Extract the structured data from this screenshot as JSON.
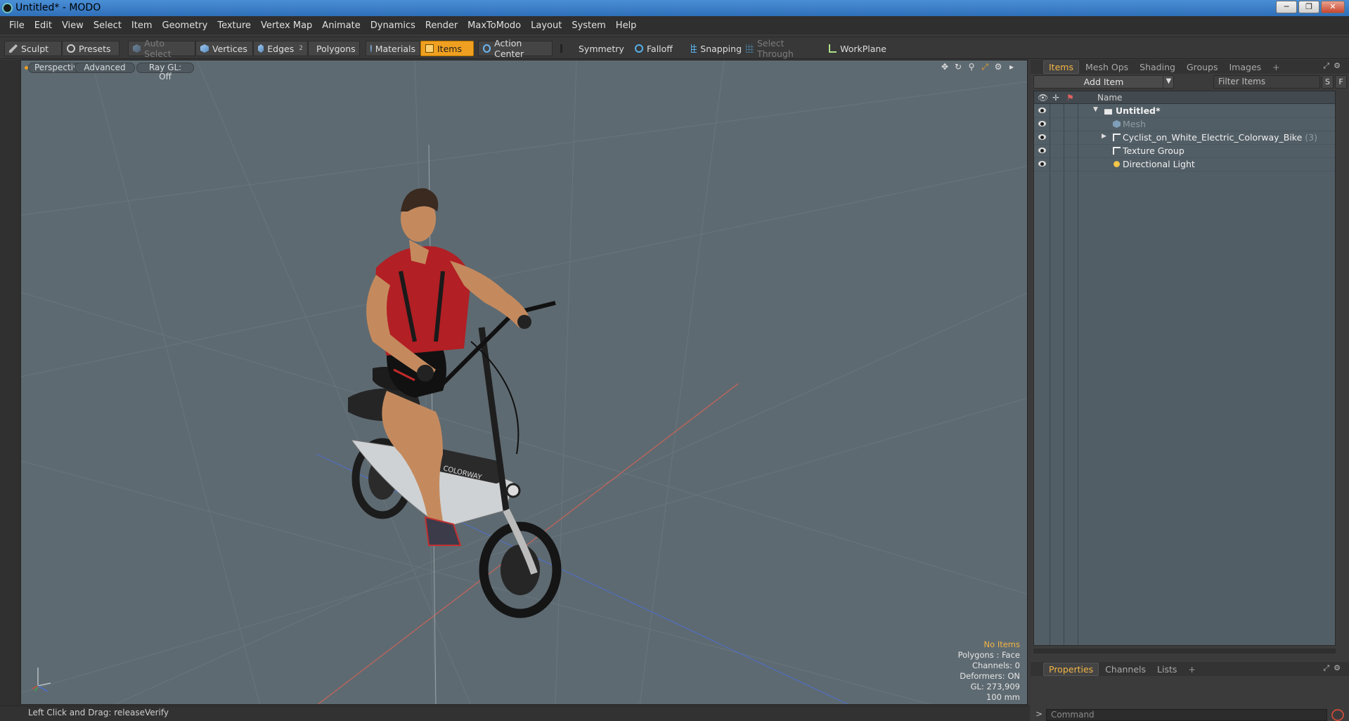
{
  "window": {
    "title": "Untitled* - MODO",
    "controls": [
      "─",
      "❐",
      "✕"
    ]
  },
  "menu": [
    "File",
    "Edit",
    "View",
    "Select",
    "Item",
    "Geometry",
    "Texture",
    "Vertex Map",
    "Animate",
    "Dynamics",
    "Render",
    "MaxToModo",
    "Layout",
    "System",
    "Help"
  ],
  "toolbar": {
    "sculpt": "Sculpt",
    "presets": "Presets",
    "auto_select": "Auto Select",
    "vertices": "Vertices",
    "edges": "Edges",
    "edges_count": "2",
    "polygons": "Polygons",
    "materials": "Materials",
    "items": "Items",
    "action_center": "Action Center",
    "symmetry": "Symmetry",
    "falloff": "Falloff",
    "snapping": "Snapping",
    "select_through": "Select Through",
    "workplane": "WorkPlane",
    "accent_color": "#f0a020"
  },
  "viewport": {
    "view_mode": "Perspective",
    "shading": "Advanced",
    "raygl": "Ray GL: Off",
    "background_color": "#5e6a71",
    "icons": [
      "move-icon",
      "rotate-icon",
      "zoom-icon",
      "maximize-icon",
      "gear-icon",
      "play-icon"
    ],
    "stats": {
      "selection": "No Items",
      "polygons": "Polygons : Face",
      "channels": "Channels: 0",
      "deformers": "Deformers: ON",
      "gl": "GL: 273,909",
      "grid": "100 mm"
    }
  },
  "status_bar": {
    "hint": "Left Click and Drag:  releaseVerify"
  },
  "items_panel": {
    "tabs": [
      "Items",
      "Mesh Ops",
      "Shading",
      "Groups",
      "Images",
      "+"
    ],
    "active_tab": "Items",
    "add_item": "Add Item",
    "filter_placeholder": "Filter Items",
    "filter_s": "S",
    "filter_f": "F",
    "column_name": "Name",
    "items": [
      {
        "label": "Untitled*",
        "count": "",
        "icon": "scene-icon",
        "expanded": true
      },
      {
        "label": "Mesh",
        "count": "",
        "icon": "mesh-icon",
        "dimmed": true
      },
      {
        "label": "Cyclist_on_White_Electric_Colorway_Bike",
        "count": "(3)",
        "icon": "group-icon",
        "collapsed": true
      },
      {
        "label": "Texture Group",
        "count": "",
        "icon": "group-icon"
      },
      {
        "label": "Directional Light",
        "count": "",
        "icon": "light-icon"
      }
    ]
  },
  "properties_panel": {
    "tabs": [
      "Properties",
      "Channels",
      "Lists",
      "+"
    ],
    "active_tab": "Properties",
    "command_placeholder": "Command",
    "command_prompt": ">"
  }
}
